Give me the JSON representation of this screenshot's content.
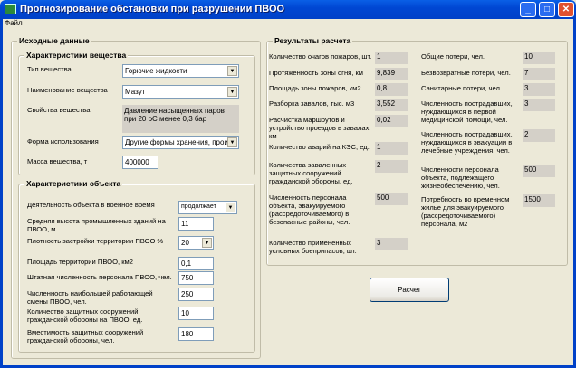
{
  "window": {
    "title": "Прогнозирование обстановки при разрушении ПВОО",
    "min": "_",
    "max": "□",
    "close": "✕"
  },
  "menu": {
    "file": "Файл"
  },
  "input": {
    "title": "Исходные данные",
    "substance": {
      "title": "Характеристики вещества",
      "type_label": "Тип вещества",
      "type_value": "Горючие жидкости",
      "name_label": "Наименование вещества",
      "name_value": "Мазут",
      "props_label": "Свойства вещества",
      "props_value": "Давление насыщенных паров при 20 оС менее 0,3 бар",
      "form_label": "Форма использования",
      "form_value": "Другие формы хранения, произ",
      "mass_label": "Масса вещества, т",
      "mass_value": "400000"
    },
    "object": {
      "title": "Характеристики объекта",
      "activity_label": "Деятельность объекта в военное время",
      "activity_value": "продолжает",
      "height_label": "Средняя высота промышленных зданий на ПВОО, м",
      "height_value": "11",
      "density_label": "Плотность застройки  территории ПВОО %",
      "density_value": "20",
      "area_label": "Площадь территории ПВОО, км2",
      "area_value": "0,1",
      "staff_label": "Штатная численность персонала ПВОО, чел.",
      "staff_value": "750",
      "shift_label": "Численность наибольшей работающей смены ПВОО, чел.",
      "shift_value": "250",
      "shelters_label": "Количество защитных сооружений гражданской обороны на ПВОО, ед.",
      "shelters_value": "10",
      "capacity_label": "Вместимость защитных сооружений гражданской обороны, чел.",
      "capacity_value": "180"
    }
  },
  "results": {
    "title": "Результаты расчета",
    "left": [
      {
        "label": "Количество очагов пожаров, шт.",
        "value": "1"
      },
      {
        "label": "Протяженность зоны огня, км",
        "value": "9,839"
      },
      {
        "label": "Площадь зоны пожаров, км2",
        "value": "0,8"
      },
      {
        "label": "Разборка завалов, тыс. м3",
        "value": "3,552"
      },
      {
        "label": "Расчистка маршрутов и устройство проездов в завалах, км",
        "value": "0,02"
      },
      {
        "label": "Количество аварий на КЭС, ед.",
        "value": "1"
      },
      {
        "label": "Количества заваленных защитных сооружений гражданской обороны, ед.",
        "value": "2"
      },
      {
        "label": "Численность персонала объекта, эвакуируемого (рассредоточиваемого) в безопасные районы, чел.",
        "value": "500"
      },
      {
        "label": "Количество примененных условных боеприпасов, шт.",
        "value": "3"
      }
    ],
    "right": [
      {
        "label": "Общие потери, чел.",
        "value": "10"
      },
      {
        "label": "Безвозвратные потери, чел.",
        "value": "7"
      },
      {
        "label": "Санитарные потери, чел.",
        "value": "3"
      },
      {
        "label": "Численность пострадавших, нуждающихся в первой медицинской помощи, чел.",
        "value": "3"
      },
      {
        "label": "Численность пострадавших, нуждающихся в эвакуации в лечебные учреждения, чел.",
        "value": "2"
      },
      {
        "label": "Численности персонала объекта, подлежащего жизнеобеспечению, чел.",
        "value": "500"
      },
      {
        "label": "Потребность во временном жилье для эвакуируемого (рассредоточиваемого) персонала, м2",
        "value": "1500"
      }
    ],
    "calc_button": "Расчет"
  }
}
